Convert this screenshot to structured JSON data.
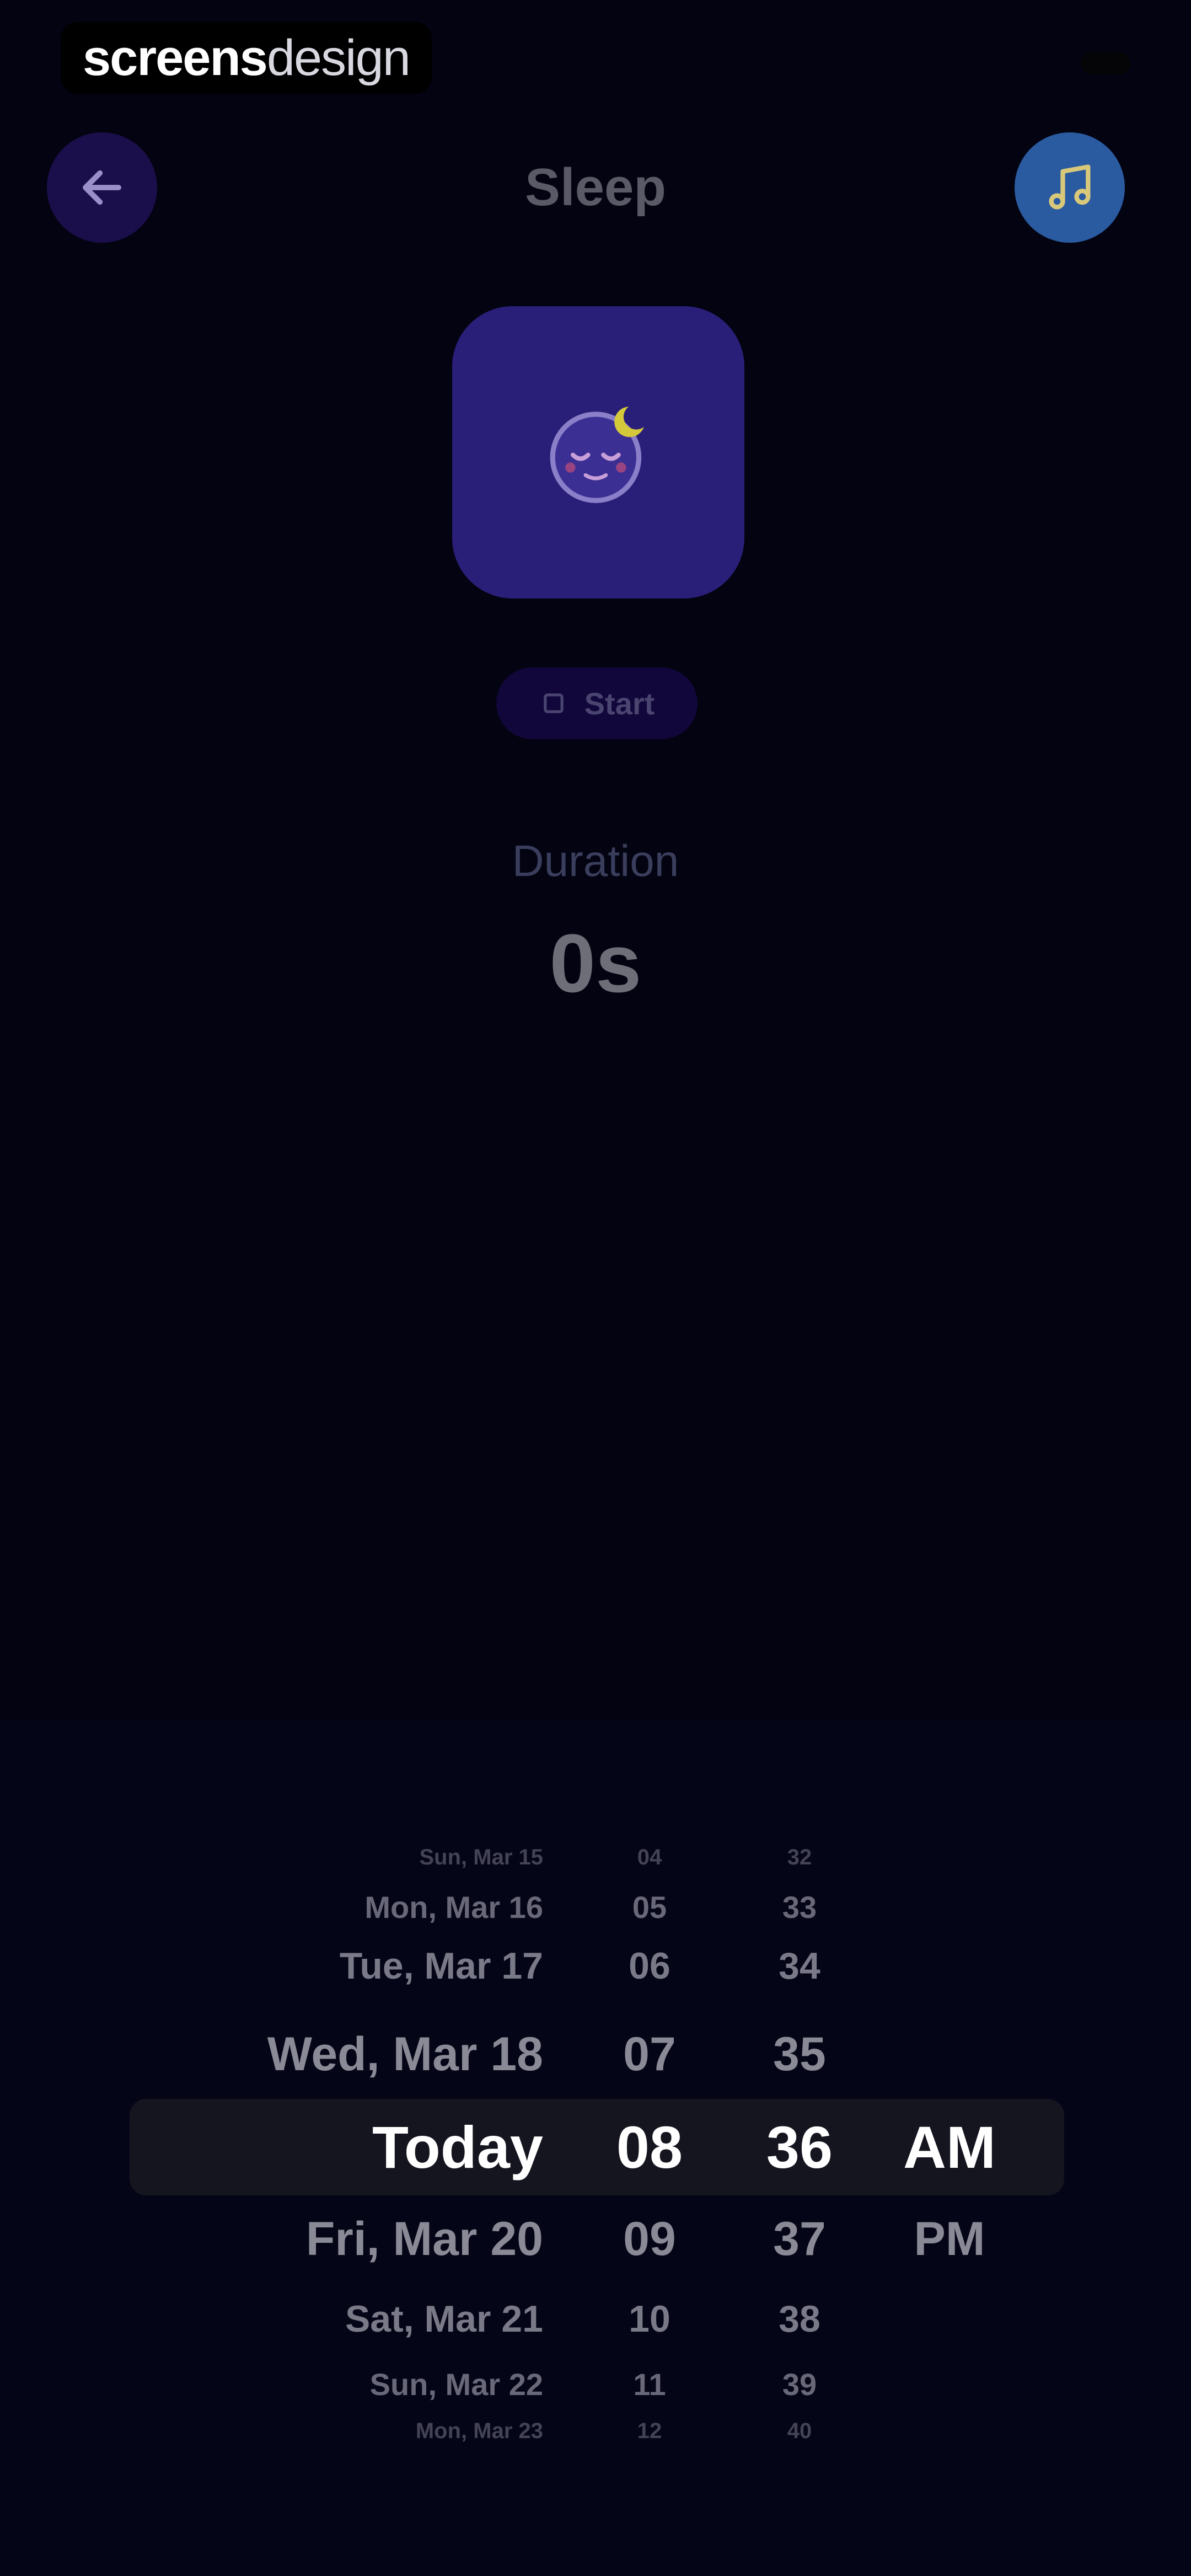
{
  "brand": {
    "part1": "screens",
    "part2": "design"
  },
  "header": {
    "title": "Sleep"
  },
  "colors": {
    "background": "#030312",
    "card": "#2a1f78",
    "back_button": "#1a0f4a",
    "music_button": "#2a5aa0",
    "moon": "#d4c93a"
  },
  "icons": {
    "back": "arrow-left-icon",
    "music": "music-note-icon",
    "sleep": "sleeping-face-icon",
    "start": "stop-square-icon"
  },
  "start_button": {
    "label": "Start"
  },
  "duration": {
    "label": "Duration",
    "value": "0s"
  },
  "picker": {
    "dates": [
      "Sun, Mar 15",
      "Mon, Mar 16",
      "Tue, Mar 17",
      "Wed, Mar 18",
      "Today",
      "Fri, Mar 20",
      "Sat, Mar 21",
      "Sun, Mar 22",
      "Mon, Mar 23"
    ],
    "hours": [
      "04",
      "05",
      "06",
      "07",
      "08",
      "09",
      "10",
      "11",
      "12"
    ],
    "minutes": [
      "32",
      "33",
      "34",
      "35",
      "36",
      "37",
      "38",
      "39",
      "40"
    ],
    "ampm": [
      "AM",
      "PM"
    ]
  }
}
